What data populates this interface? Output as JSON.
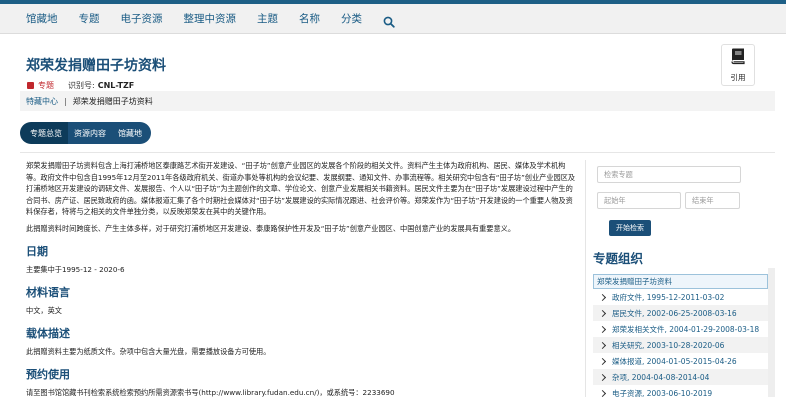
{
  "nav": {
    "items": [
      "馆藏地",
      "专题",
      "电子资源",
      "整理中资源",
      "主题",
      "名称",
      "分类"
    ]
  },
  "header": {
    "title": "郑荣发捐赠田子坊资料",
    "badge": "专题",
    "id_label": "识别号:",
    "id_value": "CNL-TZF",
    "cite_label": "引用"
  },
  "breadcrumb": {
    "root": "特藏中心",
    "separator": "|",
    "current": "郑荣发捐赠田子坊资料"
  },
  "tabs": [
    "专题总览",
    "资源内容",
    "馆藏地"
  ],
  "content": {
    "intro": "郑荣发捐赠田子坊资料包含上海打浦桥地区泰康路艺术街开发建设、“田子坊”创意产业园区的发展各个阶段的相关文件。资料产生主体为政府机构、居民、媒体及学术机构等。政府文件中包含自1995年12月至2011年各级政府机关、街道办事处等机构的会议纪要、发展纲要、通知文件、办事流程等。相关研究中包含有“田子坊”创业产业园区及打浦桥地区开发建设的调研文件、发展报告、个人以“田子坊”为主题创作的文章、学位论文、创意产业发展相关书籍资料。居民文件主要为在“田子坊”发展建设过程中产生的合同书、房产证、居民致政府的函。媒体报道汇集了各个时期社会媒体对“田子坊”发展建设的实际情况跟进、社会评价等。郑荣发作为“田子坊”开发建设的一个重要人物及资料保存者，特将与之相关的文件单独分类，以反映郑荣发在其中的关键作用。",
    "intro2": "此捐赠资料时间跨度长、产生主体多样，对于研究打浦桥地区开发建设、泰康路保护性开发及“田子坊”创意产业园区、中国创意产业的发展具有重要意义。",
    "date_heading": "日期",
    "date_text": "主要集中于1995-12 - 2020-6",
    "lang_heading": "材料语言",
    "lang_text": "中文，英文",
    "carrier_heading": "载体描述",
    "carrier_text": "此捐赠资料主要为纸质文件。杂项中包含大量光盘，需要播放设备方可使用。",
    "booking_heading": "预约使用",
    "booking_text": "请至图书馆馆藏书刊检索系统检索预约所需资源索书号(http://www.library.fudan.edu.cn/)，或系统号：2233690"
  },
  "sidebar": {
    "search_placeholder": "检索专题",
    "start_placeholder": "起始年",
    "end_placeholder": "结束年",
    "search_button": "开始检索",
    "title": "专题组织",
    "root": "郑荣发捐赠田子坊资料",
    "items": [
      "政府文件, 1995-12-2011-03-02",
      "居民文件, 2002-06-25-2008-03-16",
      "郑荣发相关文件, 2004-01-29-2008-03-18",
      "相关研究, 2003-10-28-2020-06",
      "媒体报道, 2004-01-05-2015-04-26",
      "杂项, 2004-04-08-2014-04",
      "电子资源, 2003-06-10-2019"
    ]
  },
  "colors": {
    "brand": "#1b4f78",
    "badge": "#c0272d"
  }
}
